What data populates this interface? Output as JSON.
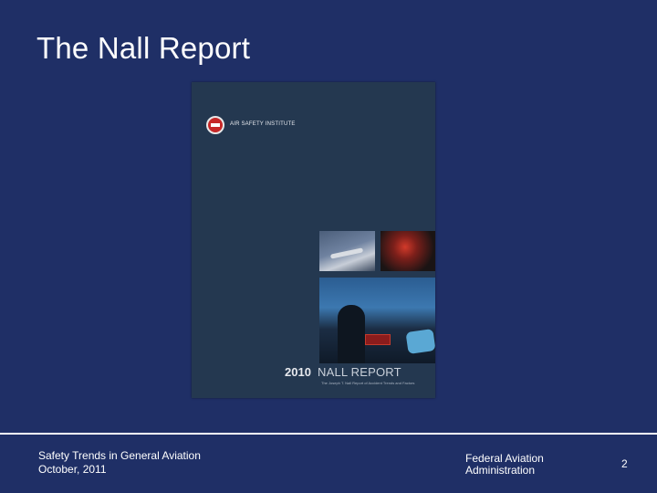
{
  "slide": {
    "title": "The Nall Report"
  },
  "cover": {
    "brand": "AIR SAFETY INSTITUTE",
    "year": "2010",
    "report_title": "NALL REPORT",
    "tagline": "The Joseph T. Nall Report of Accident Trends and Factors"
  },
  "footer": {
    "presentation_title": "Safety Trends in General Aviation",
    "date": "October, 2011",
    "agency_line1": "Federal Aviation",
    "agency_line2": "Administration",
    "page_number": "2"
  },
  "colors": {
    "background": "#1f2f66",
    "text": "#ffffff",
    "cover_background": "#243850"
  }
}
